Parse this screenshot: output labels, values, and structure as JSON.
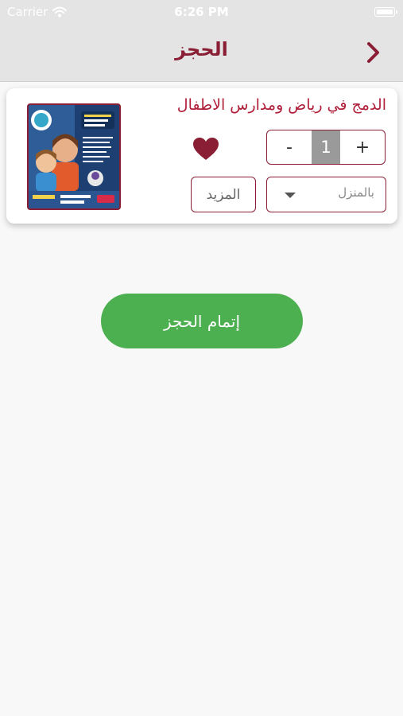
{
  "status_bar": {
    "carrier": "Carrier",
    "time": "6:26 PM"
  },
  "nav": {
    "title": "الحجز",
    "back_icon": "chevron-right-icon"
  },
  "cart_item": {
    "title": "الدمج في رياض  ومدارس الاطفال",
    "quantity": "1",
    "decrement_label": "-",
    "increment_label": "+",
    "delivery_option": "بالمنزل",
    "more_label": "المزيد",
    "favorite_icon": "heart-icon",
    "favorited": true
  },
  "actions": {
    "complete_label": "إتمام الحجز"
  },
  "colors": {
    "brand": "#8a1e35",
    "title_red": "#b0203a",
    "accent_green": "#4caf50",
    "nav_bg": "#e4e4e4",
    "page_bg": "#f8f8f8"
  }
}
